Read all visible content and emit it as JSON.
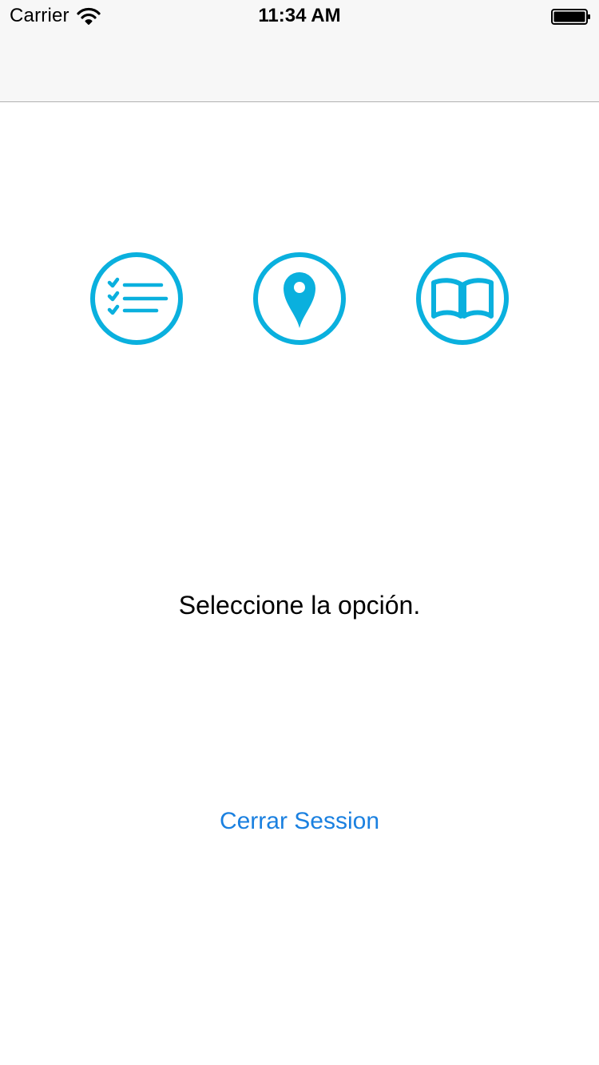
{
  "status_bar": {
    "carrier": "Carrier",
    "time": "11:34 AM",
    "icons": [
      "wifi-icon",
      "battery-icon"
    ]
  },
  "menu": {
    "accent_color": "#0ab0de",
    "options": [
      {
        "icon": "checklist-icon"
      },
      {
        "icon": "map-pin-icon"
      },
      {
        "icon": "book-icon"
      }
    ]
  },
  "main": {
    "prompt": "Seleccione la opción."
  },
  "footer": {
    "logout_label": "Cerrar Session",
    "link_color": "#1a80e0"
  }
}
